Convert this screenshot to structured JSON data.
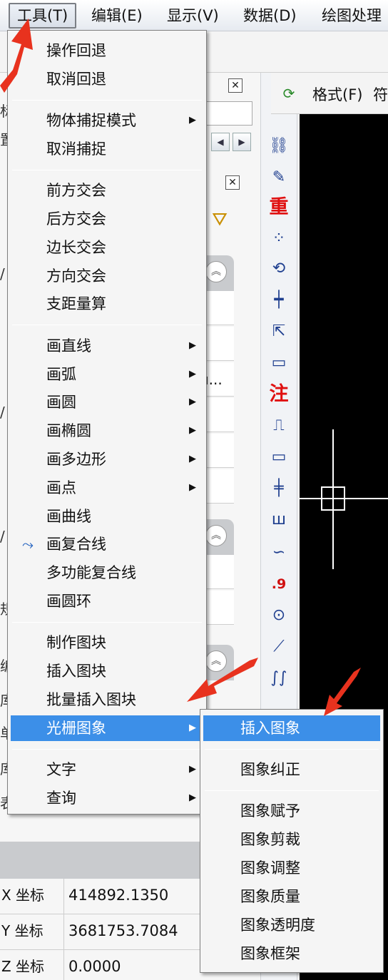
{
  "menubar": {
    "items": [
      "工具(T)",
      "编辑(E)",
      "显示(V)",
      "数据(D)",
      "绘图处理"
    ]
  },
  "toolbar": {
    "format_label": "格式(F)",
    "format_overflow": "符"
  },
  "left_panel": {
    "edge_glyphs": [
      "标",
      "置",
      "/",
      "/",
      "/",
      "规",
      "编",
      "库",
      "单",
      "库",
      "表"
    ],
    "cell_texts": [
      "u...",
      "r"
    ],
    "close_glyph": "✕",
    "collapse_glyph": "︽",
    "scroll_left": "◀",
    "scroll_right": "▶"
  },
  "properties": {
    "rows": [
      {
        "label": "X 坐标",
        "value": "414892.1350"
      },
      {
        "label": "Y 坐标",
        "value": "3681753.7084"
      },
      {
        "label": "Z 坐标",
        "value": "0.0000"
      }
    ]
  },
  "vertical_toolbar": {
    "icons": [
      {
        "name": "link-icon",
        "glyph": "⛓"
      },
      {
        "name": "edit-icon",
        "glyph": "✎"
      },
      {
        "name": "heavy-icon",
        "glyph": "重"
      },
      {
        "name": "points-grid-icon",
        "glyph": "⁘"
      },
      {
        "name": "rotate-icon",
        "glyph": "⟲"
      },
      {
        "name": "crosshair-bar-icon",
        "glyph": "┿"
      },
      {
        "name": "axis-icon",
        "glyph": "⇱"
      },
      {
        "name": "ruler-icon",
        "glyph": "▭"
      },
      {
        "name": "note-icon",
        "glyph": "注"
      },
      {
        "name": "step-icon",
        "glyph": "⎍"
      },
      {
        "name": "rectangle-icon",
        "glyph": "▭"
      },
      {
        "name": "rail-icon",
        "glyph": "╪"
      },
      {
        "name": "comb-icon",
        "glyph": "ш"
      },
      {
        "name": "curve-icon",
        "glyph": "∽"
      },
      {
        "name": "decimal-icon",
        "glyph": ".9"
      },
      {
        "name": "circle-dot-icon",
        "glyph": "⊙"
      },
      {
        "name": "line-icon",
        "glyph": "⟋"
      },
      {
        "name": "wave-icon",
        "glyph": "∫∫"
      }
    ]
  },
  "main_menu": {
    "groups": [
      [
        {
          "label": "操作回退"
        },
        {
          "label": "取消回退"
        }
      ],
      [
        {
          "label": "物体捕捉模式",
          "submenu": true
        },
        {
          "label": "取消捕捉"
        }
      ],
      [
        {
          "label": "前方交会"
        },
        {
          "label": "后方交会"
        },
        {
          "label": "边长交会"
        },
        {
          "label": "方向交会"
        },
        {
          "label": "支距量算"
        }
      ],
      [
        {
          "label": "画直线",
          "submenu": true
        },
        {
          "label": "画弧",
          "submenu": true
        },
        {
          "label": "画圆",
          "submenu": true
        },
        {
          "label": "画椭圆",
          "submenu": true
        },
        {
          "label": "画多边形",
          "submenu": true
        },
        {
          "label": "画点",
          "submenu": true
        },
        {
          "label": "画曲线"
        },
        {
          "label": "画复合线",
          "icon": "polyline-icon"
        },
        {
          "label": "多功能复合线"
        },
        {
          "label": "画圆环"
        }
      ],
      [
        {
          "label": "制作图块"
        },
        {
          "label": "插入图块"
        },
        {
          "label": "批量插入图块"
        },
        {
          "label": "光栅图象",
          "submenu": true,
          "highlighted": true
        }
      ],
      [
        {
          "label": "文字",
          "submenu": true
        },
        {
          "label": "查询",
          "submenu": true
        }
      ]
    ],
    "submenu_arrow": "▶"
  },
  "raster_submenu": {
    "groups": [
      [
        {
          "label": "插入图象",
          "highlighted": true
        }
      ],
      [
        {
          "label": "图象纠正"
        }
      ],
      [
        {
          "label": "图象赋予"
        },
        {
          "label": "图象剪裁"
        },
        {
          "label": "图象调整"
        },
        {
          "label": "图象质量"
        },
        {
          "label": "图象透明度"
        },
        {
          "label": "图象框架"
        }
      ]
    ]
  },
  "colors": {
    "highlight": "#3c8fe8",
    "annotation_arrow": "#e8321e",
    "canvas": "#000000"
  }
}
